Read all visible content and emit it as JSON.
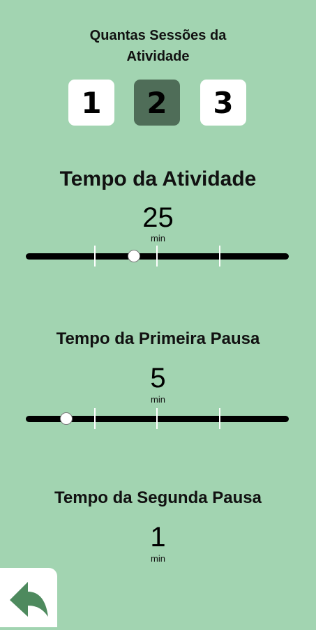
{
  "sessions": {
    "title_line1": "Quantas Sessões da",
    "title_line2": "Atividade",
    "options": [
      "1",
      "2",
      "3"
    ],
    "selected": "2"
  },
  "activity": {
    "title": "Tempo da Atividade",
    "value": "25",
    "unit": "min",
    "slider_fraction": 0.41
  },
  "first_pause": {
    "title": "Tempo da Primeira Pausa",
    "value": "5",
    "unit": "min",
    "slider_fraction": 0.155
  },
  "second_pause": {
    "title": "Tempo da Segunda Pausa",
    "value": "1",
    "unit": "min"
  },
  "colors": {
    "background": "#a2d4b1",
    "selected_session": "#4f6d58",
    "back_arrow": "#4e8a5e"
  },
  "icons": {
    "back": "back-arrow-icon"
  }
}
